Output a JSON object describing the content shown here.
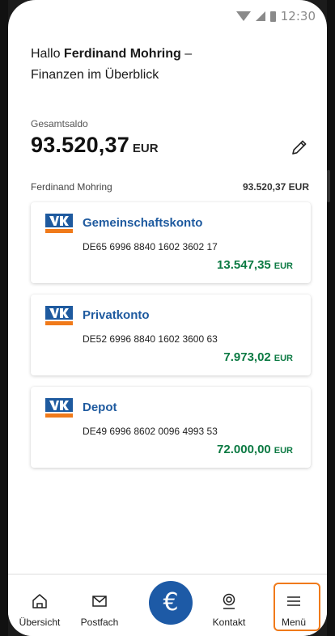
{
  "status": {
    "time": "12:30"
  },
  "greeting": {
    "hallo": "Hallo",
    "name": "Ferdinand Mohring",
    "dash": "–",
    "subtitle": "Finanzen im Überblick"
  },
  "saldo": {
    "label": "Gesamtsaldo",
    "amount": "93.520,37",
    "currency": "EUR"
  },
  "owner": {
    "name": "Ferdinand Mohring",
    "total": "93.520,37 EUR"
  },
  "accounts": [
    {
      "name": "Gemeinschaftskonto",
      "iban": "DE65 6996 8840 1602 3602 17",
      "amount": "13.547,35",
      "currency": "EUR"
    },
    {
      "name": "Privatkonto",
      "iban": "DE52 6996 8840 1602 3600 63",
      "amount": "7.973,02",
      "currency": "EUR"
    },
    {
      "name": "Depot",
      "iban": "DE49 6996 8602 0096 4993 53",
      "amount": "72.000,00",
      "currency": "EUR"
    }
  ],
  "nav": {
    "overview": "Übersicht",
    "postfach": "Postfach",
    "transfer_symbol": "€",
    "kontakt": "Kontakt",
    "menu": "Menü"
  },
  "colors": {
    "brand_blue": "#1e5a9f",
    "positive_green": "#0c7a43",
    "highlight_orange": "#f07a1a",
    "logo_orange": "#f07a1a"
  },
  "icons": [
    "wifi-icon",
    "signal-icon",
    "battery-icon",
    "pencil-icon",
    "bank-logo-icon",
    "home-icon",
    "mail-icon",
    "euro-icon",
    "contact-icon",
    "menu-icon"
  ]
}
